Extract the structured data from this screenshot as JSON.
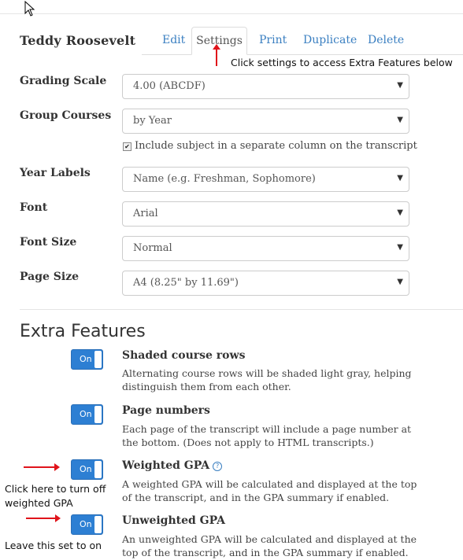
{
  "student_name": "Teddy Roosevelt",
  "tabs": [
    {
      "label": "Edit"
    },
    {
      "label": "Settings"
    },
    {
      "label": "Print"
    },
    {
      "label": "Duplicate"
    },
    {
      "label": "Delete"
    }
  ],
  "annotations": {
    "settings_hint": "Click settings to access Extra Features below",
    "weighted_hint_line1": "Click here to turn off",
    "weighted_hint_line2": "weighted GPA",
    "unweighted_hint": "Leave this set to on"
  },
  "settings": {
    "grading_scale": {
      "label": "Grading Scale",
      "value": "4.00 (ABCDF)"
    },
    "group_courses": {
      "label": "Group Courses",
      "value": "by Year"
    },
    "include_subject": {
      "label": "Include subject in a separate column on the transcript",
      "checked": true
    },
    "year_labels": {
      "label": "Year Labels",
      "value": "Name (e.g. Freshman, Sophomore)"
    },
    "font": {
      "label": "Font",
      "value": "Arial"
    },
    "font_size": {
      "label": "Font Size",
      "value": "Normal"
    },
    "page_size": {
      "label": "Page Size",
      "value": "A4 (8.25\" by 11.69\")"
    }
  },
  "extra_features": {
    "heading": "Extra Features",
    "items": [
      {
        "title": "Shaded course rows",
        "state": "On",
        "desc": "Alternating course rows will be shaded light gray, helping distinguish them from each other."
      },
      {
        "title": "Page numbers",
        "state": "On",
        "desc": "Each page of the transcript will include a page number at the bottom. (Does not apply to HTML transcripts.)"
      },
      {
        "title": "Weighted GPA",
        "state": "On",
        "help": "?",
        "desc": "A weighted GPA will be calculated and displayed at the top of the transcript, and in the GPA summary if enabled."
      },
      {
        "title": "Unweighted GPA",
        "state": "On",
        "desc": "An unweighted GPA will be calculated and displayed at the top of the transcript, and in the GPA summary if enabled."
      }
    ]
  },
  "colors": {
    "accent": "#2d7fd3",
    "link": "#3a7fc1",
    "annotation_arrow": "#e0141b"
  },
  "icons": {
    "cursor": "mouse-pointer-icon",
    "caret": "caret-down-icon",
    "help": "question-circle-icon"
  }
}
